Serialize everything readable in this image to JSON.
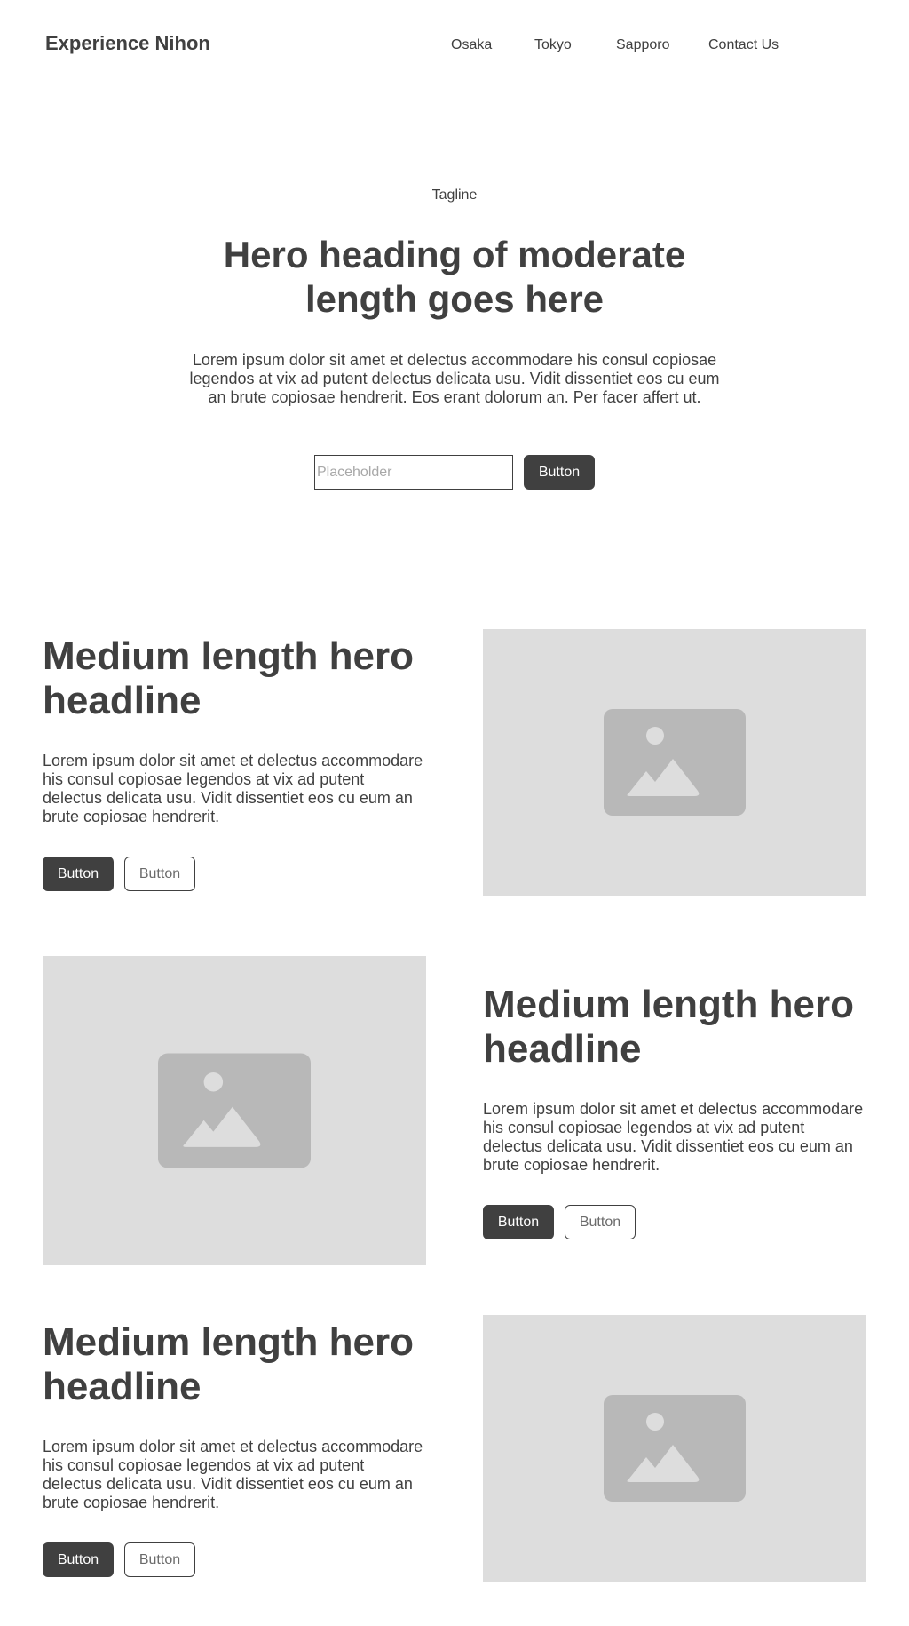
{
  "header": {
    "brand": "Experience Nihon",
    "nav": [
      "Osaka",
      "Tokyo",
      "Sapporo",
      "Contact Us"
    ]
  },
  "hero": {
    "tagline": "Tagline",
    "heading": "Hero heading of moderate length goes here",
    "body": "Lorem ipsum dolor sit amet et delectus accommodare his consul copiosae legendos at vix ad putent delectus delicata usu. Vidit dissentiet eos cu eum an brute copiosae hendrerit. Eos erant dolorum an. Per facer affert ut.",
    "input_placeholder": "Placeholder",
    "button": "Button"
  },
  "features": [
    {
      "title": "Medium length hero headline",
      "body": "Lorem ipsum dolor sit amet et delectus accommodare his consul copiosae legendos at vix ad putent delectus delicata usu. Vidit dissentiet eos cu eum an brute copiosae hendrerit.",
      "primary": "Button",
      "secondary": "Button",
      "image_icon": "image-placeholder-icon"
    },
    {
      "title": "Medium length hero headline",
      "body": "Lorem ipsum dolor sit amet et delectus accommodare his consul copiosae legendos at vix ad putent delectus delicata usu. Vidit dissentiet eos cu eum an brute copiosae hendrerit.",
      "primary": "Button",
      "secondary": "Button",
      "image_icon": "image-placeholder-icon"
    },
    {
      "title": "Medium length hero headline",
      "body": "Lorem ipsum dolor sit amet et delectus accommodare his consul copiosae legendos at vix ad putent delectus delicata usu. Vidit dissentiet eos cu eum an brute copiosae hendrerit.",
      "primary": "Button",
      "secondary": "Button",
      "image_icon": "image-placeholder-icon"
    }
  ],
  "colors": {
    "text": "#404040",
    "button_primary_bg": "#404040",
    "button_primary_text": "#ffffff",
    "button_secondary_text": "#6b6b6b",
    "image_bg": "#dddddd",
    "image_icon": "#b8b8b8"
  }
}
